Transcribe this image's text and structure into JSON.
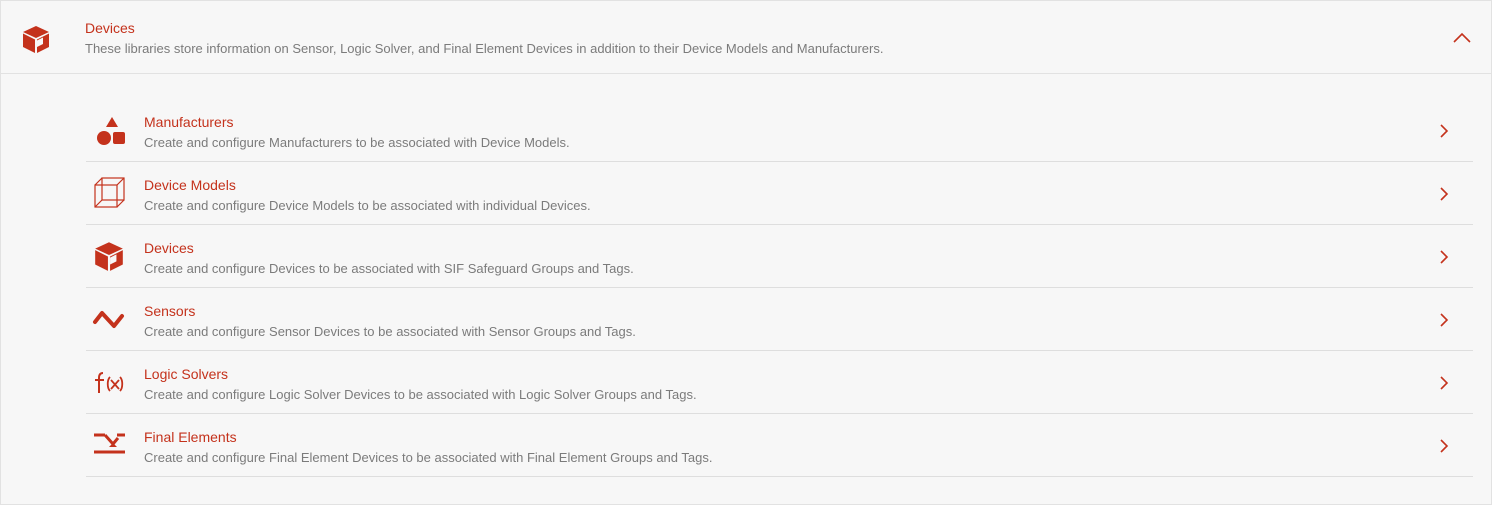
{
  "section": {
    "title": "Devices",
    "description": "These libraries store information on Sensor, Logic Solver, and Final Element Devices in addition to their Device Models and Manufacturers.",
    "icon": "cube-icon",
    "collapse_icon": "chevron-up-icon"
  },
  "colors": {
    "accent": "#c4321c",
    "muted_text": "#7b7b7b",
    "divider": "#dedede",
    "background": "#f7f7f7"
  },
  "items": [
    {
      "title": "Manufacturers",
      "description": "Create and configure Manufacturers to be associated with Device Models.",
      "icon": "shapes-icon"
    },
    {
      "title": "Device Models",
      "description": "Create and configure Device Models to be associated with individual Devices.",
      "icon": "wireframe-cube-icon"
    },
    {
      "title": "Devices",
      "description": "Create and configure Devices to be associated with SIF Safeguard Groups and Tags.",
      "icon": "cube-icon"
    },
    {
      "title": "Sensors",
      "description": "Create and configure Sensor Devices to be associated with Sensor Groups and Tags.",
      "icon": "zigzag-icon"
    },
    {
      "title": "Logic Solvers",
      "description": "Create and configure Logic Solver Devices to be associated with Logic Solver Groups and Tags.",
      "icon": "function-icon"
    },
    {
      "title": "Final Elements",
      "description": "Create and configure Final Element Devices to be associated with Final Element Groups and Tags.",
      "icon": "valve-icon"
    }
  ]
}
